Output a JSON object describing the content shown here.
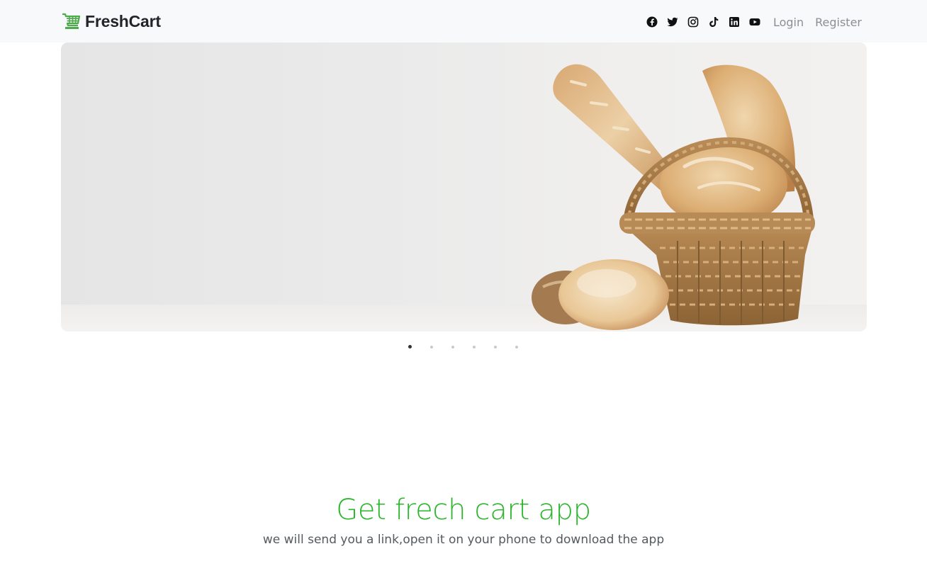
{
  "navbar": {
    "brand": "FreshCart",
    "social_icons": [
      "facebook-icon",
      "twitter-icon",
      "instagram-icon",
      "tiktok-icon",
      "linkedin-icon",
      "youtube-icon"
    ],
    "login_label": "Login",
    "register_label": "Register"
  },
  "slider": {
    "image": "bread-basket-image",
    "slide_count": 6,
    "active_slide": 1
  },
  "app_promo": {
    "title": "Get frech cart app",
    "subtitle": "we will send you a link,open it on your phone to download the app"
  },
  "colors": {
    "brand_green": "#4fa94d",
    "title_green": "#2bb52b",
    "navbar_bg": "#f8f9fa"
  }
}
